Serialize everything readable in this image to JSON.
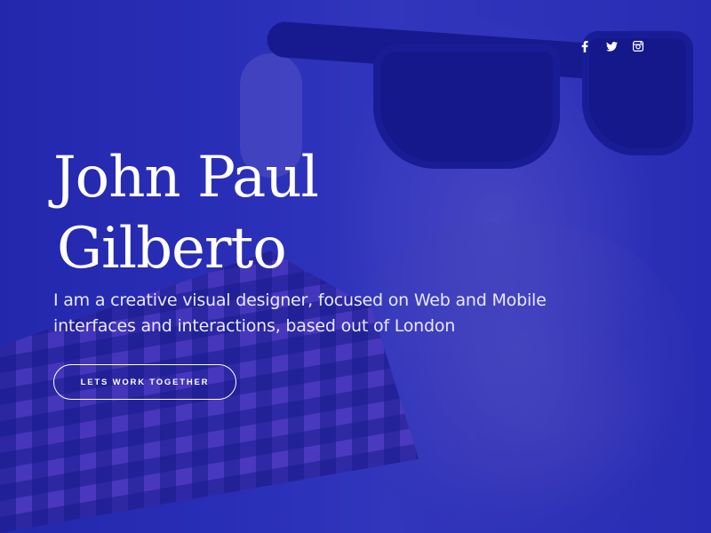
{
  "hero": {
    "name_line_1": "John Paul",
    "name_line_2": "Gilberto",
    "tagline": "I am a creative visual designer, focused on Web and Mobile interfaces and interactions, based out of London",
    "cta_label": "LETS WORK TOGETHER",
    "overlay_color": "#2a2fb6"
  },
  "social": {
    "icons": [
      "facebook-icon",
      "twitter-icon",
      "instagram-icon"
    ]
  },
  "colors": {
    "text": "#ffffff",
    "overlay": "#2a2fb6",
    "glasses": "#0f1275"
  }
}
